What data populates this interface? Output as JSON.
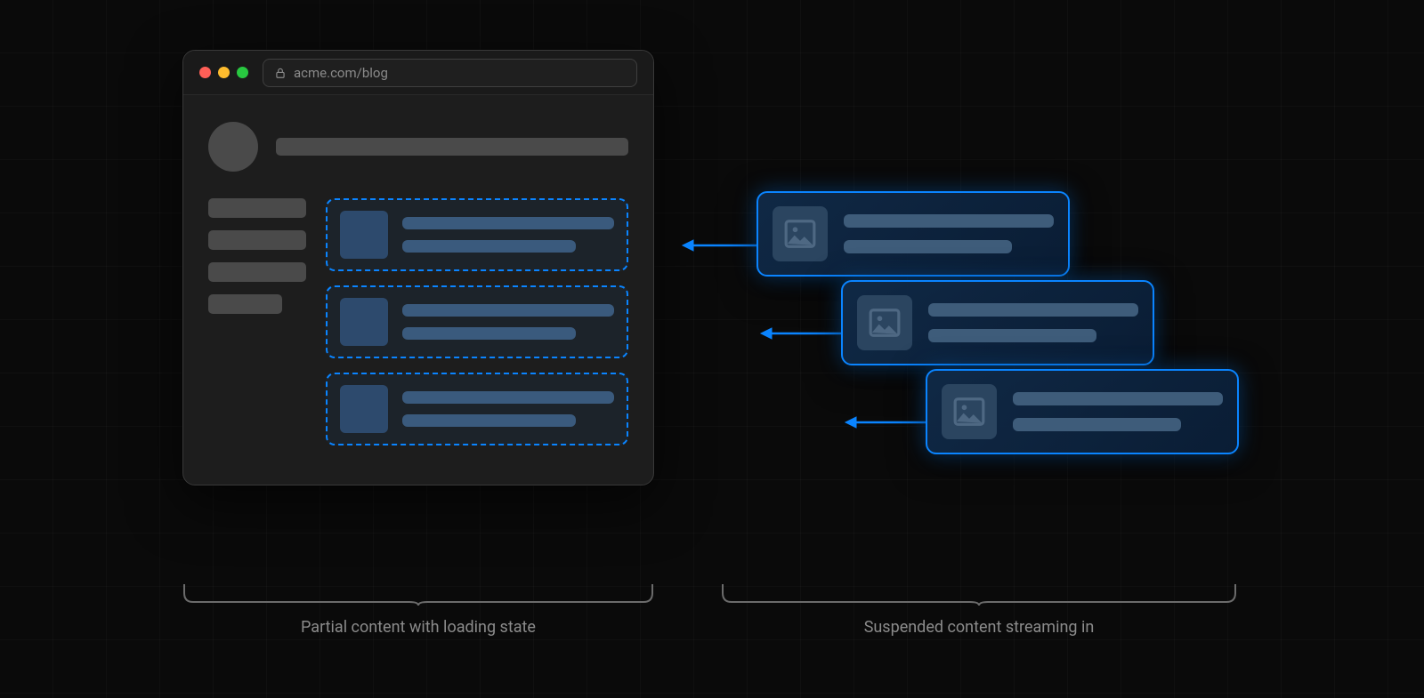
{
  "url": "acme.com/blog",
  "captions": {
    "left": "Partial content with loading state",
    "right": "Suspended content streaming in"
  },
  "colors": {
    "accent": "#0a84ff",
    "background": "#0a0a0a",
    "panel": "#1d1d1d",
    "skeleton": "#4a4a4a"
  },
  "traffic_lights": [
    "close",
    "minimize",
    "maximize"
  ],
  "loading_slots": 3,
  "streaming_cards": 3,
  "sidebar_items": 4
}
